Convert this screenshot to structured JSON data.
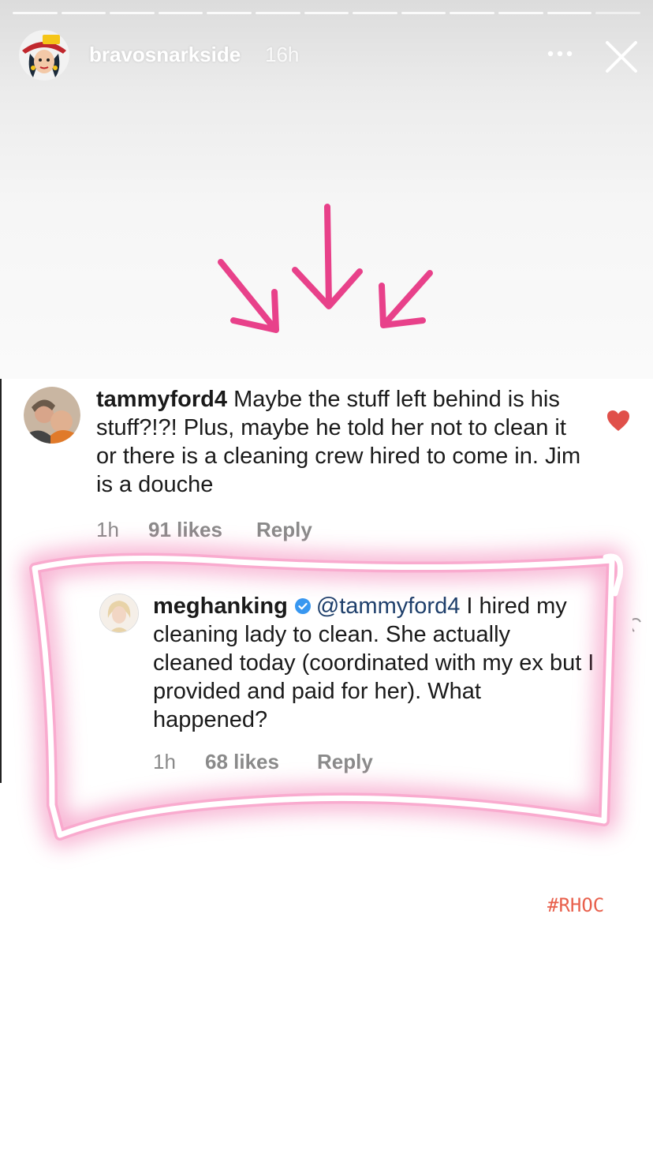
{
  "story": {
    "username": "bravosnarkside",
    "time_ago": "16h",
    "segments_total": 13,
    "avatar_icon": "cartoon-woman-avatar",
    "more_icon": "more-dots-icon",
    "close_icon": "close-icon"
  },
  "screenshot": {
    "comment": {
      "username": "tammyford4",
      "text": "Maybe the stuff left behind is his stuff?!?! Plus, maybe he told her not to clean it or there is a cleaning crew hired to come in. Jim is a douche",
      "time": "1h",
      "likes": "91 likes",
      "reply_label": "Reply",
      "liked": true
    },
    "reply": {
      "username": "meghanking",
      "verified": true,
      "mention": "@tammyford4",
      "text": "I hired my cleaning lady to clean. She actually cleaned today (coordinated with my ex but I provided and paid for her). What happened?",
      "time": "1h",
      "likes": "68 likes",
      "reply_label": "Reply"
    }
  },
  "hashtag": "#RHOC",
  "colors": {
    "arrow_pink": "#e8418a",
    "glow_pink": "#f06aa8",
    "heart_red": "#e0504a",
    "hashtag_text": "#e8604c"
  }
}
